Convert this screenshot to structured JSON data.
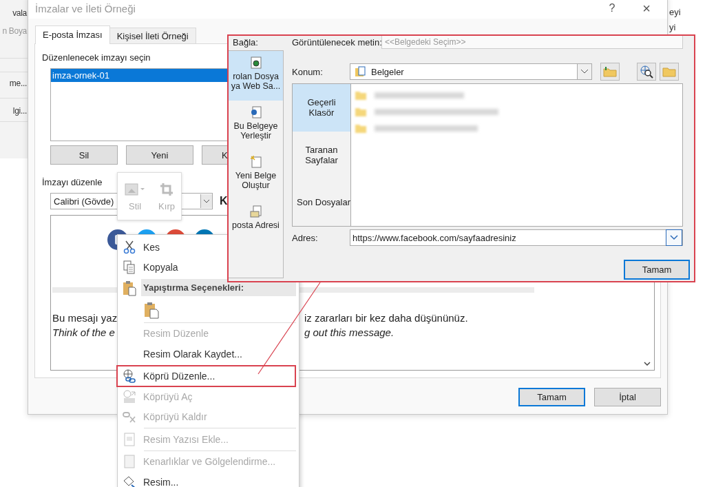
{
  "background_app": {
    "left_texts": [
      {
        "text": "vala",
        "disabled": false
      },
      {
        "text": "n Boya",
        "disabled": true
      },
      {
        "text": "me...",
        "disabled": false
      },
      {
        "text": "lgi...",
        "disabled": false
      }
    ],
    "right_texts": [
      "eyi",
      "yi"
    ]
  },
  "dialog": {
    "title": "İmzalar ve İleti Örneği",
    "help": "?",
    "close": "×",
    "tabs": [
      {
        "label": "E-posta İmzası",
        "selected": true
      },
      {
        "label": "Kişisel İleti Örneği",
        "selected": false
      }
    ],
    "signature_group": "Düzenlenecek imzayı seçin",
    "signatures": [
      {
        "label": "imza-ornek-01",
        "selected": true
      }
    ],
    "signature_buttons": [
      "Sil",
      "Yeni",
      "K"
    ],
    "edit_group": "İmzayı düzenle",
    "font": "Calibri (Gövde)",
    "bold_button": "K",
    "body_lines": [
      {
        "left": "Bu mesajı yaz",
        "right": "iz zararları bir kez daha düşününüz.",
        "italic": false
      },
      {
        "left": "Think of the e",
        "right": "g out this message.",
        "italic": true
      }
    ],
    "buttons": [
      {
        "label": "Tamam",
        "default": true
      },
      {
        "label": "İptal",
        "default": false
      }
    ]
  },
  "mini_toolbar": {
    "items": [
      {
        "label": "Stil",
        "disabled": true
      },
      {
        "label": "Kırp",
        "disabled": true
      }
    ]
  },
  "context_menu": {
    "items": [
      {
        "kind": "item",
        "label": "Kes",
        "disabled": false,
        "selected": false
      },
      {
        "kind": "item",
        "label": "Kopyala",
        "disabled": false,
        "selected": false
      },
      {
        "kind": "header",
        "label": "Yapıştırma Seçenekleri:"
      },
      {
        "kind": "paste"
      },
      {
        "kind": "separator"
      },
      {
        "kind": "item",
        "label": "Resim Düzenle",
        "disabled": true,
        "selected": false
      },
      {
        "kind": "item",
        "label": "Resim Olarak Kaydet...",
        "disabled": false,
        "selected": false
      },
      {
        "kind": "separator"
      },
      {
        "kind": "item",
        "label": "Köprü Düzenle...",
        "disabled": false,
        "selected": true
      },
      {
        "kind": "item",
        "label": "Köprüyü Aç",
        "disabled": true,
        "selected": false
      },
      {
        "kind": "item",
        "label": "Köprüyü Kaldır",
        "disabled": true,
        "selected": false
      },
      {
        "kind": "separator"
      },
      {
        "kind": "item",
        "label": "Resim Yazısı Ekle...",
        "disabled": true,
        "selected": false
      },
      {
        "kind": "separator"
      },
      {
        "kind": "item",
        "label": "Kenarlıklar ve Gölgelendirme...",
        "disabled": true,
        "selected": false
      },
      {
        "kind": "item",
        "label": "Resim...",
        "disabled": false,
        "selected": false
      }
    ]
  },
  "hyperlink_dialog": {
    "link_to_label": "Bağla:",
    "link_targets": [
      {
        "label": "rolan Dosya\nya Web Sa...",
        "selected": true
      },
      {
        "label": "Bu Belgeye\nYerleştir",
        "selected": false
      },
      {
        "label": "Yeni Belge\nOluştur",
        "selected": false
      },
      {
        "label": "posta Adresi",
        "selected": false
      }
    ],
    "display_text_label": "Görüntülenecek metin:",
    "display_text": "<<Belgedeki Seçim>>",
    "location_label": "Konum:",
    "location": "Belgeler",
    "browse_tabs": [
      {
        "label": "Geçerli\nKlasör",
        "selected": true
      },
      {
        "label": "Taranan\nSayfalar",
        "selected": false
      },
      {
        "label": "Son Dosyalar",
        "selected": false
      }
    ],
    "address_label": "Adres:",
    "address": "https://www.facebook.com/sayfaadresiniz",
    "ok_button": "Tamam"
  }
}
